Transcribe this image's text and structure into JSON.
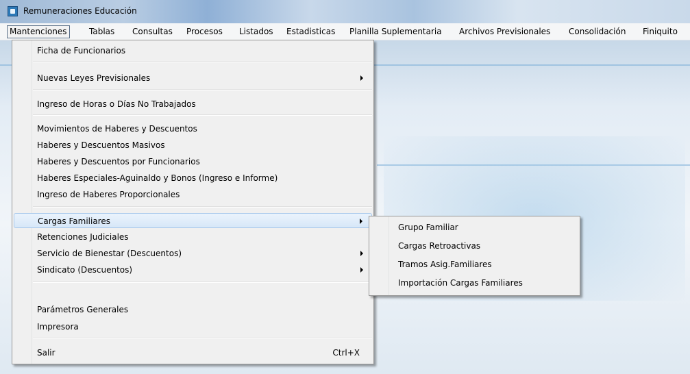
{
  "window": {
    "title": "Remuneraciones Educación",
    "icon": "app-icon"
  },
  "menubar": [
    "Mantenciones",
    "Tablas",
    "Consultas",
    "Procesos",
    "Listados",
    "Estadisticas",
    "Planilla Suplementaria",
    "Archivos Previsionales",
    "Consolidación",
    "Finiquito"
  ],
  "menu": {
    "items": [
      {
        "label": "Ficha de Funcionarios"
      },
      {
        "label": "Nuevas Leyes Previsionales",
        "submenu": true
      },
      {
        "label": "Ingreso de Horas o Días No Trabajados"
      },
      {
        "label": "Movimientos de Haberes y Descuentos"
      },
      {
        "label": "Haberes y Descuentos Masivos"
      },
      {
        "label": "Haberes y Descuentos por Funcionarios"
      },
      {
        "label": "Haberes Especiales-Aguinaldo y Bonos (Ingreso e Informe)"
      },
      {
        "label": "Ingreso de Haberes Proporcionales"
      },
      {
        "label": "Cargas Familiares",
        "submenu": true,
        "highlighted": true
      },
      {
        "label": "Retenciones Judiciales"
      },
      {
        "label": "Servicio de Bienestar (Descuentos)",
        "submenu": true
      },
      {
        "label": "Sindicato (Descuentos)",
        "submenu": true
      },
      {
        "label": "Parámetros Generales"
      },
      {
        "label": "Impresora"
      },
      {
        "label": "Salir",
        "shortcut": "Ctrl+X"
      }
    ]
  },
  "submenu": {
    "items": [
      {
        "label": "Grupo Familiar"
      },
      {
        "label": "Cargas Retroactivas"
      },
      {
        "label": "Tramos Asig.Familiares"
      },
      {
        "label": "Importación Cargas Familiares"
      }
    ]
  },
  "colors": {
    "menu_bg": "#f0f0f0",
    "highlight_border": "#a9c9ec",
    "menubar_bg": "#f5f6f7"
  }
}
